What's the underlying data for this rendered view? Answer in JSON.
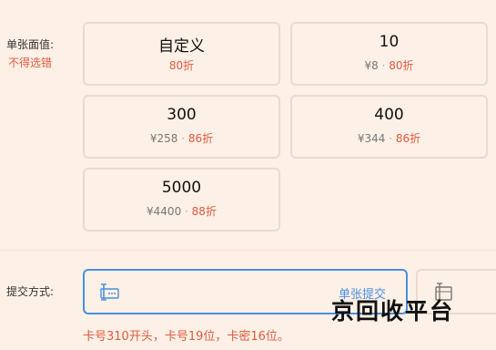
{
  "denomination": {
    "label": "单张面值:",
    "note": "不得选错",
    "options": [
      {
        "main": "自定义",
        "price": "",
        "discount": "80折"
      },
      {
        "main": "10",
        "price": "¥8",
        "discount": "80折"
      },
      {
        "main": "300",
        "price": "¥258",
        "discount": "86折"
      },
      {
        "main": "400",
        "price": "¥344",
        "discount": "86折"
      },
      {
        "main": "5000",
        "price": "¥4400",
        "discount": "88折"
      }
    ]
  },
  "submit_method": {
    "label": "提交方式:",
    "options": [
      {
        "label": "单张提交",
        "icon": "single-card-icon",
        "selected": true
      },
      {
        "label": "",
        "icon": "batch-card-icon",
        "selected": false
      }
    ]
  },
  "hint": "卡号310开头，卡号19位，卡密16位。",
  "watermark": "京回收平台",
  "colors": {
    "accent": "#4a90e2",
    "discount": "#e25a3f",
    "background": "#fdf0e6",
    "border": "#ecd8cf"
  }
}
